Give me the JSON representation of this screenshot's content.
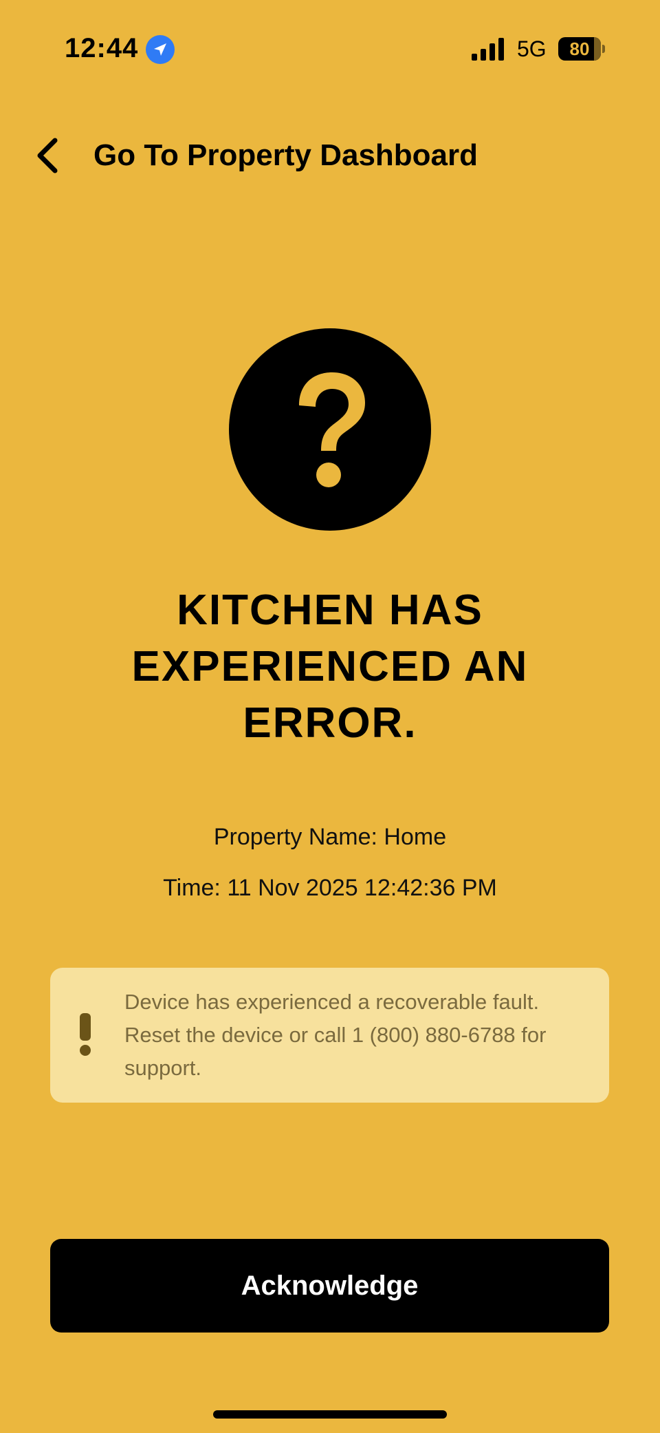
{
  "status_bar": {
    "time": "12:44",
    "network": "5G",
    "battery": "80",
    "icons": [
      "location-arrow-icon",
      "cellular-signal-icon",
      "battery-icon"
    ]
  },
  "nav": {
    "back_icon": "chevron-left-icon",
    "title": "Go To Property Dashboard"
  },
  "alert": {
    "icon": "question-circle-icon",
    "heading": "KITCHEN HAS EXPERIENCED AN ERROR.",
    "property_line": "Property Name: Home",
    "time_line": "Time: 11 Nov 2025 12:42:36 PM"
  },
  "notice": {
    "icon": "exclamation-icon",
    "text": "Device has experienced a recoverable fault. Reset the device or call 1 (800) 880-6788 for support."
  },
  "actions": {
    "acknowledge_label": "Acknowledge"
  },
  "colors": {
    "background": "#EBB73E",
    "notice_background": "#F7E19D",
    "notice_text": "#7A6A3E",
    "button_background": "#000000",
    "button_text": "#FFFFFF",
    "location_icon": "#2F7BF5"
  }
}
